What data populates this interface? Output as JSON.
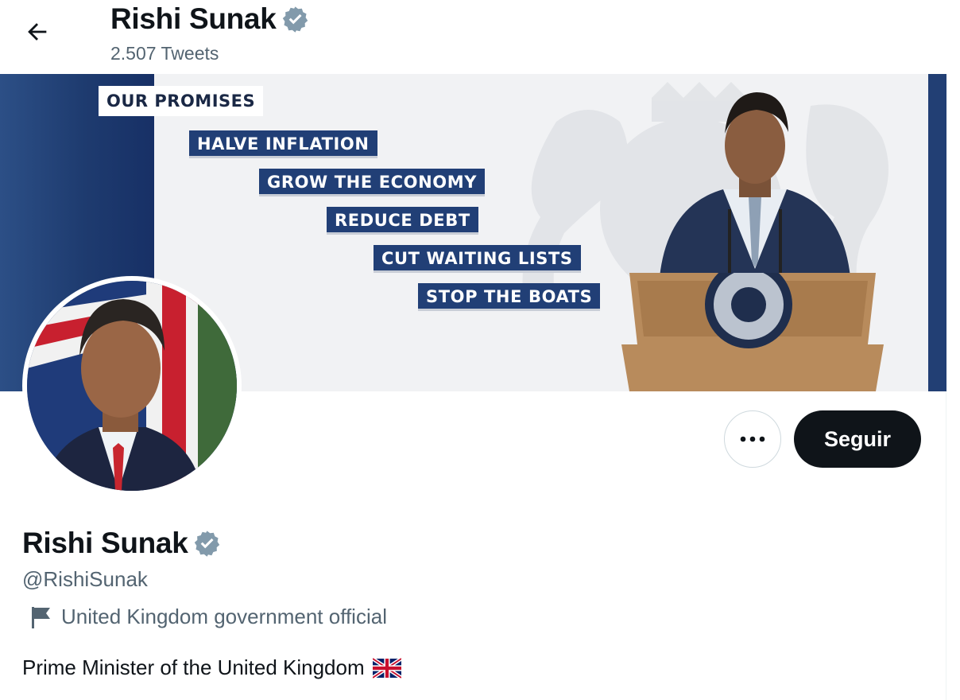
{
  "header": {
    "name": "Rishi Sunak",
    "tweet_count": "2.507 Tweets"
  },
  "banner": {
    "title": "OUR PROMISES",
    "promises": [
      "HALVE INFLATION",
      "GROW THE ECONOMY",
      "REDUCE DEBT",
      "CUT WAITING LISTS",
      "STOP THE BOATS"
    ]
  },
  "profile": {
    "name": "Rishi Sunak",
    "handle": "@RishiSunak",
    "affiliation": "United Kingdom government official",
    "bio": "Prime Minister of the United Kingdom"
  },
  "actions": {
    "more_label": "•••",
    "follow_label": "Seguir"
  },
  "icons": {
    "back": "arrow-left-icon",
    "verified": "verified-badge-icon",
    "affiliation": "flag-icon",
    "more": "more-horizontal-icon"
  },
  "colors": {
    "text_primary": "#0f1419",
    "text_secondary": "#536471",
    "verified_badge": "#829aab",
    "banner_blue": "#213f76",
    "follow_bg": "#0f1419"
  }
}
